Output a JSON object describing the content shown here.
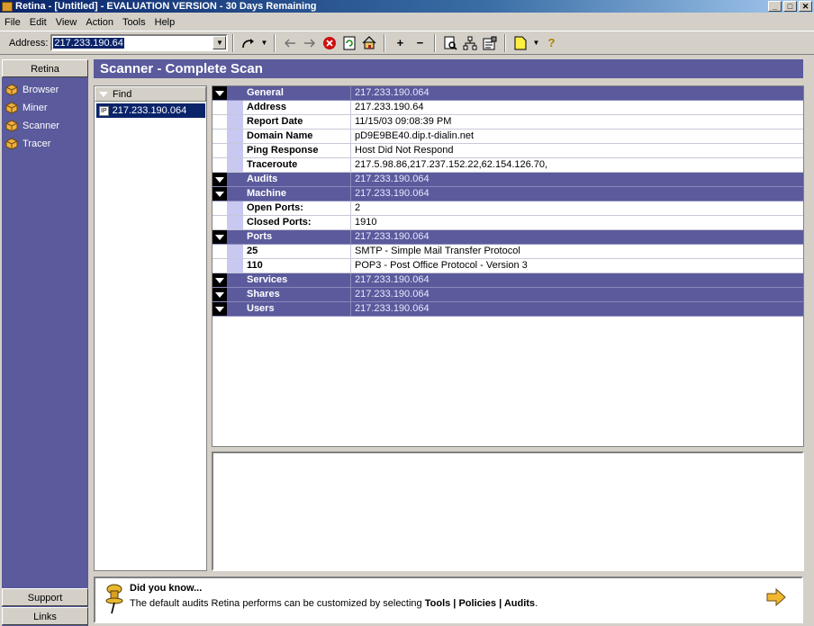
{
  "window": {
    "title": "Retina - [Untitled] - EVALUATION VERSION - 30  Days Remaining",
    "controls": {
      "minimize": "_",
      "maximize": "□",
      "close": "✕"
    }
  },
  "menu": [
    "File",
    "Edit",
    "View",
    "Action",
    "Tools",
    "Help"
  ],
  "toolbar": {
    "address_label": "Address:",
    "address_value": "217.233.190.64",
    "buttons": [
      "back-arrow",
      "nav-prev",
      "nav-next",
      "stop",
      "refresh",
      "home",
      "zoom-in",
      "zoom-out",
      "report-preview",
      "network",
      "properties",
      "new-document",
      "help"
    ],
    "add_label": "+",
    "remove_label": "−",
    "help_label": "?"
  },
  "leftnav": {
    "header": "Retina",
    "items": [
      {
        "label": "Browser",
        "icon": "hex-icon"
      },
      {
        "label": "Miner",
        "icon": "hex-icon"
      },
      {
        "label": "Scanner",
        "icon": "hex-icon"
      },
      {
        "label": "Tracer",
        "icon": "hex-icon"
      }
    ],
    "support": "Support",
    "links": "Links"
  },
  "main": {
    "title": "Scanner - Complete Scan",
    "find_header": "Find",
    "find_items": [
      {
        "ip_tag": "IP",
        "label": "217.233.190.064"
      }
    ]
  },
  "details": {
    "general": {
      "label": "General",
      "value": "217.233.190.064"
    },
    "general_rows": [
      {
        "key": "Address",
        "value": "217.233.190.64"
      },
      {
        "key": "Report Date",
        "value": "11/15/03 09:08:39 PM"
      },
      {
        "key": "Domain Name",
        "value": "pD9E9BE40.dip.t-dialin.net"
      },
      {
        "key": "Ping Response",
        "value": "Host Did Not Respond"
      },
      {
        "key": "Traceroute",
        "value": "217.5.98.86,217.237.152.22,62.154.126.70,"
      }
    ],
    "audits": {
      "label": "Audits",
      "value": "217.233.190.064"
    },
    "machine": {
      "label": "Machine",
      "value": "217.233.190.064"
    },
    "machine_rows": [
      {
        "key": "Open Ports:",
        "value": "2"
      },
      {
        "key": "Closed Ports:",
        "value": "1910"
      }
    ],
    "ports": {
      "label": "Ports",
      "value": "217.233.190.064"
    },
    "port_rows": [
      {
        "key": "25",
        "value": "SMTP - Simple Mail Transfer Protocol"
      },
      {
        "key": "110",
        "value": "POP3 - Post Office Protocol - Version 3"
      }
    ],
    "services": {
      "label": "Services",
      "value": "217.233.190.064"
    },
    "shares": {
      "label": "Shares",
      "value": "217.233.190.064"
    },
    "users": {
      "label": "Users",
      "value": "217.233.190.064"
    }
  },
  "tip": {
    "title": "Did you know...",
    "text_before": "The default audits Retina performs can be customized by selecting ",
    "tools": "Tools",
    "sep1": " | ",
    "policies": "Policies",
    "sep2": " | ",
    "audits": "Audits",
    "end": "."
  },
  "colors": {
    "accent": "#5a5a9c",
    "selection": "#0a246a",
    "face": "#d4d0c8"
  }
}
